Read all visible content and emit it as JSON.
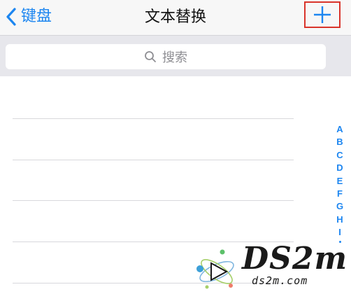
{
  "navbar": {
    "back_label": "键盘",
    "title": "文本替换"
  },
  "search": {
    "placeholder": "搜索"
  },
  "index": {
    "letters": [
      "A",
      "B",
      "C",
      "D",
      "E",
      "F",
      "G",
      "H",
      "I"
    ]
  },
  "watermark": {
    "logo_text": "DS2m",
    "url": "ds2m.com"
  },
  "colors": {
    "accent": "#1d86f0",
    "highlight_box": "#d9342b",
    "search_bg": "#e7e7ec"
  },
  "icons": [
    "chevron-left-icon",
    "plus-icon",
    "search-icon",
    "atom-logo-icon"
  ]
}
